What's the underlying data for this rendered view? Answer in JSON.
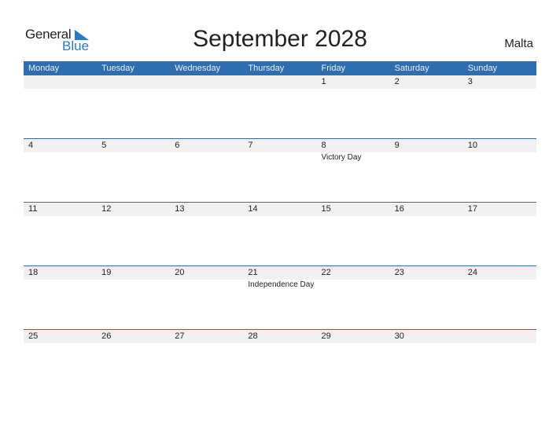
{
  "logo": {
    "general": "General",
    "blue": "Blue"
  },
  "title": "September 2028",
  "country": "Malta",
  "days": [
    "Monday",
    "Tuesday",
    "Wednesday",
    "Thursday",
    "Friday",
    "Saturday",
    "Sunday"
  ],
  "weeks": [
    {
      "dates": [
        "",
        "",
        "",
        "",
        "1",
        "2",
        "3"
      ],
      "events": [
        "",
        "",
        "",
        "",
        "",
        "",
        ""
      ]
    },
    {
      "dates": [
        "4",
        "5",
        "6",
        "7",
        "8",
        "9",
        "10"
      ],
      "events": [
        "",
        "",
        "",
        "",
        "Victory Day",
        "",
        ""
      ]
    },
    {
      "dates": [
        "11",
        "12",
        "13",
        "14",
        "15",
        "16",
        "17"
      ],
      "events": [
        "",
        "",
        "",
        "",
        "",
        "",
        ""
      ]
    },
    {
      "dates": [
        "18",
        "19",
        "20",
        "21",
        "22",
        "23",
        "24"
      ],
      "events": [
        "",
        "",
        "",
        "Independence Day",
        "",
        "",
        ""
      ]
    },
    {
      "dates": [
        "25",
        "26",
        "27",
        "28",
        "29",
        "30",
        ""
      ],
      "events": [
        "",
        "",
        "",
        "",
        "",
        "",
        ""
      ]
    }
  ]
}
